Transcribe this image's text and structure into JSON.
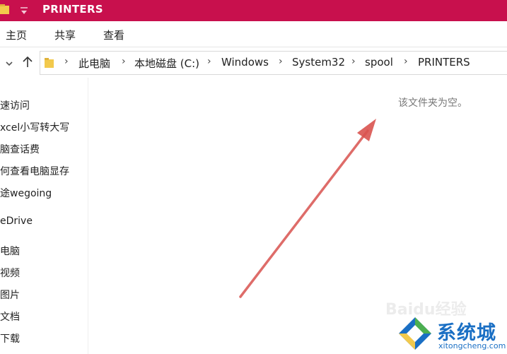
{
  "window": {
    "title": "PRINTERS"
  },
  "ribbon": {
    "tabs": [
      "主页",
      "共享",
      "查看"
    ]
  },
  "address": {
    "crumbs": [
      "此电脑",
      "本地磁盘 (C:)",
      "Windows",
      "System32",
      "spool",
      "PRINTERS"
    ],
    "separator": "›"
  },
  "sidebar": {
    "items": [
      "速访问",
      "xcel小写转大写",
      "脑查话费",
      "何查看电脑显存",
      "途wegoing",
      "eDrive",
      "电脑",
      "视频",
      "图片",
      "文档",
      "下载"
    ]
  },
  "content": {
    "empty_message": "该文件夹为空。"
  },
  "watermark": {
    "text": "Baidu经验"
  },
  "brand": {
    "name": "系统城",
    "url": "xitongcheng.com"
  },
  "colors": {
    "titlebar": "#c8104d",
    "arrow": "#d9534f",
    "brand_blue": "#1a6fc4",
    "brand_green": "#4caf50"
  },
  "icons": {
    "title_folder": "folder-icon",
    "quick_access_toggle": "dropdown-pin-icon",
    "nav_down": "chevron-down-icon",
    "nav_up": "arrow-up-icon",
    "address_folder": "folder-icon",
    "brand_logo": "diamond-logo-icon"
  }
}
